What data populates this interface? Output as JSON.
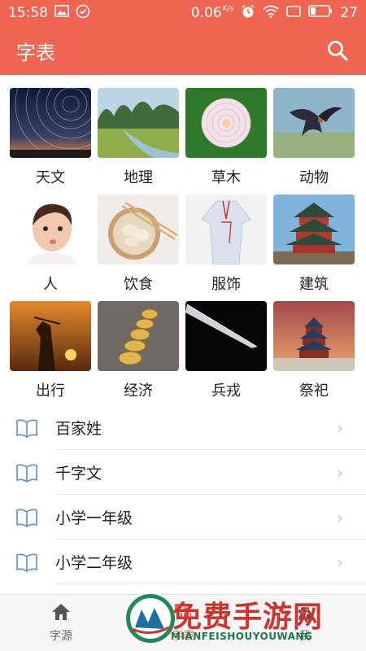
{
  "status_bar": {
    "time": "15:58",
    "speed": "0.06",
    "speed_unit": "K/s",
    "battery": "27",
    "icons": [
      "image-icon",
      "check-circle-icon",
      "alarm-icon",
      "wifi-icon",
      "screen-icon",
      "battery-icon"
    ]
  },
  "app_bar": {
    "title": "字表",
    "search_icon": "search-icon"
  },
  "categories": [
    {
      "label": "天文"
    },
    {
      "label": "地理"
    },
    {
      "label": "草木"
    },
    {
      "label": "动物"
    },
    {
      "label": "人"
    },
    {
      "label": "饮食"
    },
    {
      "label": "服饰"
    },
    {
      "label": "建筑"
    },
    {
      "label": "出行"
    },
    {
      "label": "经济"
    },
    {
      "label": "兵戎"
    },
    {
      "label": "祭祀"
    }
  ],
  "book_list": [
    {
      "label": "百家姓"
    },
    {
      "label": "千字文"
    },
    {
      "label": "小学一年级"
    },
    {
      "label": "小学二年级"
    }
  ],
  "tab_bar": {
    "tabs": [
      {
        "label": "字源",
        "icon": "home-icon"
      },
      {
        "label": "字表",
        "icon": "grid-icon"
      },
      {
        "label": "我",
        "icon": "person-icon"
      }
    ],
    "active": "字表"
  },
  "watermark": {
    "title": "免费手游网",
    "subtitle": "MIANFEISHOUYOUWANG"
  },
  "colors": {
    "accent": "#ef6551",
    "icon_blue": "#5b8fc9"
  }
}
